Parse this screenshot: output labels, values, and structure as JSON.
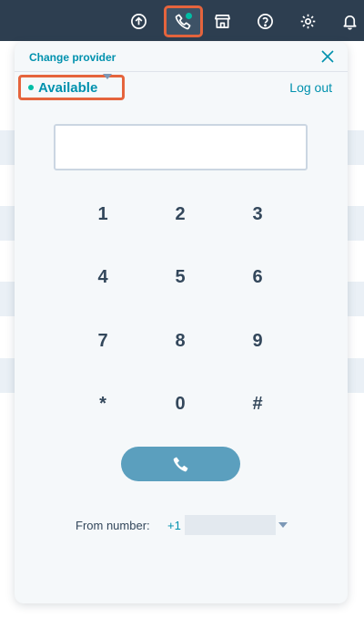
{
  "topbar": {
    "icons": [
      "upgrade-icon",
      "calling-icon",
      "marketplace-icon",
      "help-icon",
      "settings-icon",
      "notifications-icon"
    ],
    "calling_status_color": "#00bda5"
  },
  "panel": {
    "change_provider": "Change provider",
    "close_icon": "close-icon",
    "status": "Available",
    "status_color": "#00bda5",
    "logout": "Log out",
    "phone_input_value": "",
    "keys": [
      "1",
      "2",
      "3",
      "4",
      "5",
      "6",
      "7",
      "8",
      "9",
      "*",
      "0",
      "#"
    ],
    "call_icon": "phone-icon",
    "from_label": "From number:",
    "from_number_prefix": "+1 ("
  },
  "colors": {
    "nav_bg": "#2d3e50",
    "accent": "#0091ae",
    "highlight": "#e5643d",
    "call_button": "#5b9fbe"
  }
}
